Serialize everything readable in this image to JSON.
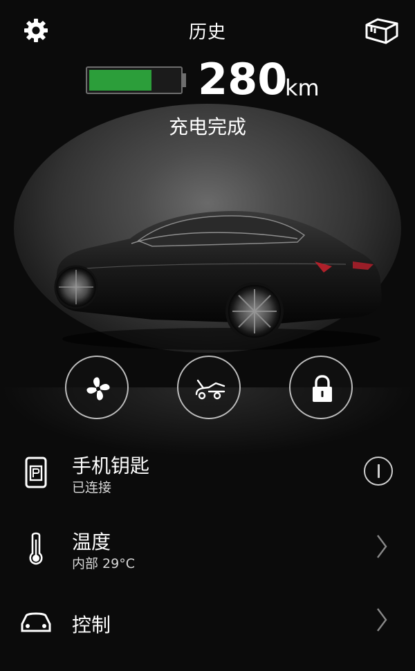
{
  "header": {
    "title": "历史",
    "settings_icon": "gear-icon",
    "box_icon": "package-icon"
  },
  "battery": {
    "level": 0.7,
    "fill_color": "#2c9e3a",
    "range_value": "280",
    "range_unit": "km",
    "status": "充电完成"
  },
  "controls": [
    {
      "name": "fan-button",
      "icon": "fan-icon"
    },
    {
      "name": "trunk-button",
      "icon": "frunk-icon"
    },
    {
      "name": "lock-button",
      "icon": "lock-icon"
    }
  ],
  "list": {
    "phone_key": {
      "title": "手机钥匙",
      "subtitle": "已连接",
      "icon": "phone-key-icon",
      "action_icon": "info-icon"
    },
    "climate": {
      "title": "温度",
      "subtitle": "内部 29°C",
      "icon": "thermometer-icon"
    },
    "controls": {
      "title": "控制",
      "icon": "car-icon"
    }
  }
}
